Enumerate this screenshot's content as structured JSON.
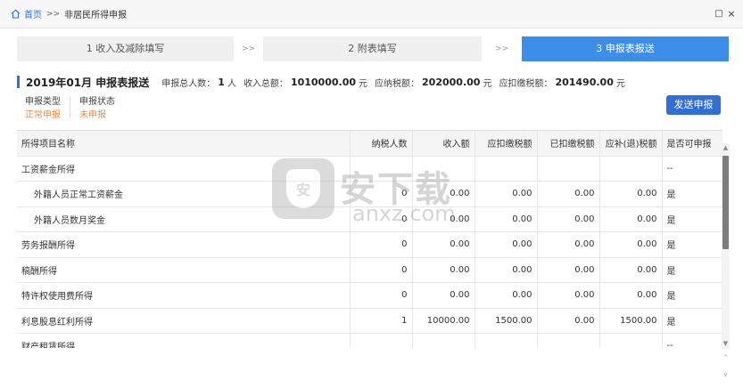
{
  "breadcrumb": {
    "home": "首页",
    "separator": ">>",
    "current": "非居民所得申报"
  },
  "window": {
    "restore": "□",
    "close": "×"
  },
  "steps": [
    {
      "label": "1 收入及减除填写",
      "active": false
    },
    {
      "label": "2 附表填写",
      "active": false
    },
    {
      "label": "3 申报表报送",
      "active": true
    }
  ],
  "step_arrow": ">>",
  "summary": {
    "title": "2019年01月  申报表报送",
    "people_label": "申报总人数：",
    "people_value": "1",
    "people_unit": "人",
    "income_label": "收入总额：",
    "income_value": "1010000.00",
    "income_unit": "元",
    "tax_due_label": "应纳税额：",
    "tax_due_value": "202000.00",
    "tax_due_unit": "元",
    "withhold_label": "应扣缴税额：",
    "withhold_value": "201490.00",
    "withhold_unit": "元"
  },
  "meta": {
    "type_label": "申报类型",
    "type_value": "正常申报",
    "status_label": "申报状态",
    "status_value": "未申报"
  },
  "send_button": "发送申报",
  "table": {
    "headers": [
      "所得项目名称",
      "纳税人数",
      "收入额",
      "应扣缴税额",
      "已扣缴税额",
      "应补(退)税额",
      "是否可申报"
    ],
    "rows": [
      {
        "name": "工资薪金所得",
        "child": false,
        "count": "",
        "income": "",
        "withhold": "",
        "paid": "",
        "refund": "",
        "ok": "--"
      },
      {
        "name": "外籍人员正常工资薪金",
        "child": true,
        "count": "0",
        "income": "0.00",
        "withhold": "0.00",
        "paid": "0.00",
        "refund": "0.00",
        "ok": "是"
      },
      {
        "name": "外籍人员数月奖金",
        "child": true,
        "count": "0",
        "income": "0.00",
        "withhold": "0.00",
        "paid": "0.00",
        "refund": "0.00",
        "ok": "是"
      },
      {
        "name": "劳务报酬所得",
        "child": false,
        "count": "0",
        "income": "0.00",
        "withhold": "0.00",
        "paid": "0.00",
        "refund": "0.00",
        "ok": "是"
      },
      {
        "name": "稿酬所得",
        "child": false,
        "count": "0",
        "income": "0.00",
        "withhold": "0.00",
        "paid": "0.00",
        "refund": "0.00",
        "ok": "是"
      },
      {
        "name": "特许权使用费所得",
        "child": false,
        "count": "0",
        "income": "0.00",
        "withhold": "0.00",
        "paid": "0.00",
        "refund": "0.00",
        "ok": "是"
      },
      {
        "name": "利息股息红利所得",
        "child": false,
        "count": "1",
        "income": "10000.00",
        "withhold": "1500.00",
        "paid": "0.00",
        "refund": "1500.00",
        "ok": "是"
      },
      {
        "name": "财产租赁所得",
        "child": false,
        "count": "",
        "income": "",
        "withhold": "",
        "paid": "",
        "refund": "",
        "ok": "--"
      }
    ]
  },
  "watermark": {
    "logo_char": "安",
    "cn": "安下载",
    "en": "anxz.com"
  },
  "colors": {
    "accent": "#2f6fd6",
    "step_active": "#3d8ee8",
    "status_orange": "#f08a3c"
  }
}
